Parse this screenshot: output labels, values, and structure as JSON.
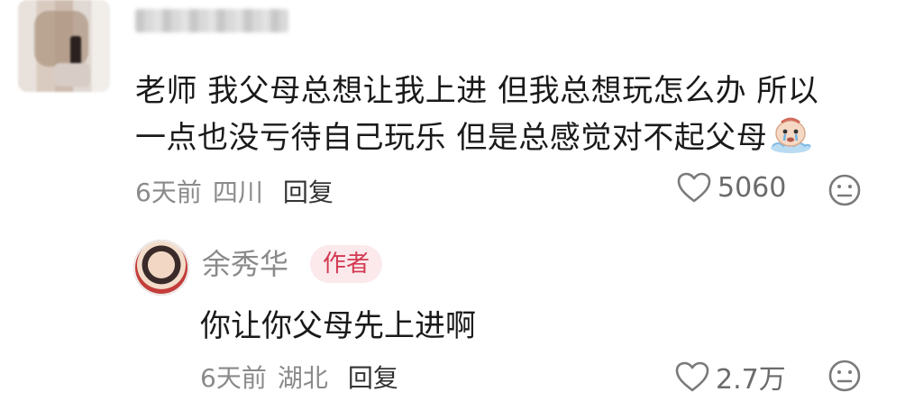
{
  "comment": {
    "line1": "老师 我父母总想让我上进 但我总想玩怎么办 所以",
    "line2": "一点也没亏待自己玩乐 但是总感觉对不起父母",
    "sticker_icon": "crying-face-sticker",
    "time": "6天前",
    "location": "四川",
    "reply_label": "回复",
    "likes": "5060"
  },
  "reply": {
    "author": "余秀华",
    "author_badge": "作者",
    "text": "你让你父母先上进啊",
    "time": "6天前",
    "location": "湖北",
    "reply_label": "回复",
    "likes": "2.7万"
  },
  "colors": {
    "text": "#1a1a1a",
    "meta": "#8a8a8a",
    "badge_bg": "#fbe9ec",
    "badge_text": "#d23a52"
  }
}
